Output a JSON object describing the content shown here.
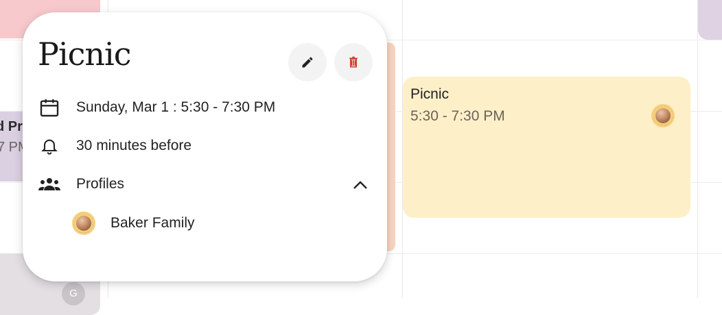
{
  "background_events": {
    "left_partial_title": "d Pr",
    "left_partial_time": "7 PM",
    "gray_avatar_initial": "G"
  },
  "calendar_event": {
    "title": "Picnic",
    "time": "5:30 - 7:30 PM",
    "color": "#fdefc8"
  },
  "popup": {
    "title": "Picnic",
    "edit_icon": "pencil-icon",
    "delete_icon": "trash-icon",
    "date_text": "Sunday, Mar 1 : 5:30 - 7:30 PM",
    "reminder_text": "30 minutes before",
    "profiles_label": "Profiles",
    "profiles": [
      {
        "name": "Baker Family"
      }
    ]
  },
  "colors": {
    "delete_accent": "#d0402b",
    "avatar_ring": "#f6cf7d"
  }
}
